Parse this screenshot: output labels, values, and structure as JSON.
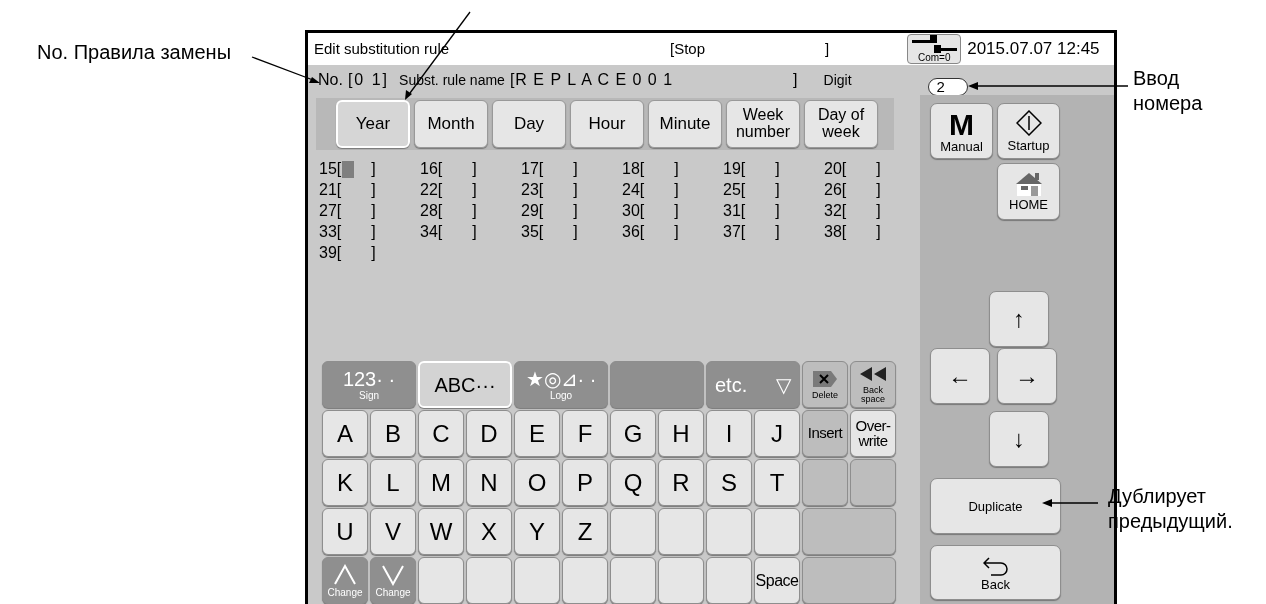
{
  "annotations": [
    {
      "text": "No. Правила замены"
    },
    {
      "text": "Ввод номера"
    },
    {
      "text": "Дублирует предыдущий."
    }
  ],
  "header": {
    "title": "Edit substitution rule",
    "status": "[Stop",
    "status_close": "]",
    "com_label": "Com=0",
    "datetime": "2015.07.07 12:45"
  },
  "info": {
    "number_label": "No.",
    "number_value": "[0 1]",
    "name_label": "Subst. rule name",
    "name_value": "[R E P L A C E 0 0 1",
    "name_close": "]",
    "digit_label": "Digit",
    "digit_value": "2"
  },
  "tabs": [
    {
      "label": "Year",
      "selected": true
    },
    {
      "label": "Month",
      "selected": false
    },
    {
      "label": "Day",
      "selected": false
    },
    {
      "label": "Hour",
      "selected": false
    },
    {
      "label": "Minute",
      "selected": false
    },
    {
      "label": "Week number",
      "selected": false
    },
    {
      "label": "Day of week",
      "selected": false
    }
  ],
  "codes": [
    {
      "label": "15[",
      "close": "]",
      "cursor": true
    },
    {
      "label": "16[",
      "close": "]",
      "cursor": false
    },
    {
      "label": "17[",
      "close": "]",
      "cursor": false
    },
    {
      "label": "18[",
      "close": "]",
      "cursor": false
    },
    {
      "label": "19[",
      "close": "]",
      "cursor": false
    },
    {
      "label": "20[",
      "close": "]",
      "cursor": false
    },
    {
      "label": "21[",
      "close": "]",
      "cursor": false
    },
    {
      "label": "22[",
      "close": "]",
      "cursor": false
    },
    {
      "label": "23[",
      "close": "]",
      "cursor": false
    },
    {
      "label": "24[",
      "close": "]",
      "cursor": false
    },
    {
      "label": "25[",
      "close": "]",
      "cursor": false
    },
    {
      "label": "26[",
      "close": "]",
      "cursor": false
    },
    {
      "label": "27[",
      "close": "]",
      "cursor": false
    },
    {
      "label": "28[",
      "close": "]",
      "cursor": false
    },
    {
      "label": "29[",
      "close": "]",
      "cursor": false
    },
    {
      "label": "30[",
      "close": "]",
      "cursor": false
    },
    {
      "label": "31[",
      "close": "]",
      "cursor": false
    },
    {
      "label": "32[",
      "close": "]",
      "cursor": false
    },
    {
      "label": "33[",
      "close": "]",
      "cursor": false
    },
    {
      "label": "34[",
      "close": "]",
      "cursor": false
    },
    {
      "label": "35[",
      "close": "]",
      "cursor": false
    },
    {
      "label": "36[",
      "close": "]",
      "cursor": false
    },
    {
      "label": "37[",
      "close": "]",
      "cursor": false
    },
    {
      "label": "38[",
      "close": "]",
      "cursor": false
    },
    {
      "label": "39[",
      "close": "]",
      "cursor": false
    }
  ],
  "keyboard": {
    "categories": [
      {
        "label": "123· ·",
        "sub": "Sign",
        "selected": false
      },
      {
        "label": "ABC···",
        "selected": true
      },
      {
        "label": "★◎⊿· ·",
        "sub": "Logo",
        "selected": false
      },
      {
        "selected": false
      },
      {
        "label": "etc.",
        "arrow": "▽",
        "selected": false
      }
    ],
    "actions": [
      {
        "kind": "delete",
        "label": "Delete"
      },
      {
        "kind": "backspace",
        "label": "Back space"
      }
    ],
    "rows": [
      [
        {
          "kind": "char",
          "label": "A"
        },
        {
          "kind": "char",
          "label": "B"
        },
        {
          "kind": "char",
          "label": "C"
        },
        {
          "kind": "char",
          "label": "D"
        },
        {
          "kind": "char",
          "label": "E"
        },
        {
          "kind": "char",
          "label": "F"
        },
        {
          "kind": "char",
          "label": "G"
        },
        {
          "kind": "char",
          "label": "H"
        },
        {
          "kind": "char",
          "label": "I"
        },
        {
          "kind": "char",
          "label": "J"
        },
        {
          "kind": "mode",
          "label": "Insert",
          "selected": true
        },
        {
          "kind": "mode",
          "label": "Over-write",
          "selected": false
        }
      ],
      [
        {
          "kind": "char",
          "label": "K"
        },
        {
          "kind": "char",
          "label": "L"
        },
        {
          "kind": "char",
          "label": "M"
        },
        {
          "kind": "char",
          "label": "N"
        },
        {
          "kind": "char",
          "label": "O"
        },
        {
          "kind": "char",
          "label": "P"
        },
        {
          "kind": "char",
          "label": "Q"
        },
        {
          "kind": "char",
          "label": "R"
        },
        {
          "kind": "char",
          "label": "S"
        },
        {
          "kind": "char",
          "label": "T"
        },
        {
          "kind": "void"
        },
        {
          "kind": "void"
        }
      ],
      [
        {
          "kind": "char",
          "label": "U"
        },
        {
          "kind": "char",
          "label": "V"
        },
        {
          "kind": "char",
          "label": "W"
        },
        {
          "kind": "char",
          "label": "X"
        },
        {
          "kind": "char",
          "label": "Y"
        },
        {
          "kind": "char",
          "label": "Z"
        },
        {
          "kind": "blank"
        },
        {
          "kind": "blank"
        },
        {
          "kind": "blank"
        },
        {
          "kind": "blank"
        },
        {
          "kind": "void",
          "wide": true
        }
      ],
      [
        {
          "kind": "change",
          "label": "Change"
        },
        {
          "kind": "change",
          "label": "Change"
        },
        {
          "kind": "blank"
        },
        {
          "kind": "blank"
        },
        {
          "kind": "blank"
        },
        {
          "kind": "blank"
        },
        {
          "kind": "blank"
        },
        {
          "kind": "blank"
        },
        {
          "kind": "blank"
        },
        {
          "kind": "space",
          "label": "Space"
        },
        {
          "kind": "void",
          "wide": true
        }
      ]
    ]
  },
  "side": {
    "manual": {
      "glyph": "M",
      "label": "Manual"
    },
    "startup": {
      "label": "Startup"
    },
    "home": {
      "label": "HOME"
    },
    "arrows": {
      "up": "↑",
      "left": "←",
      "right": "→",
      "down": "↓"
    },
    "duplicate": "Duplicate",
    "back": "Back"
  }
}
